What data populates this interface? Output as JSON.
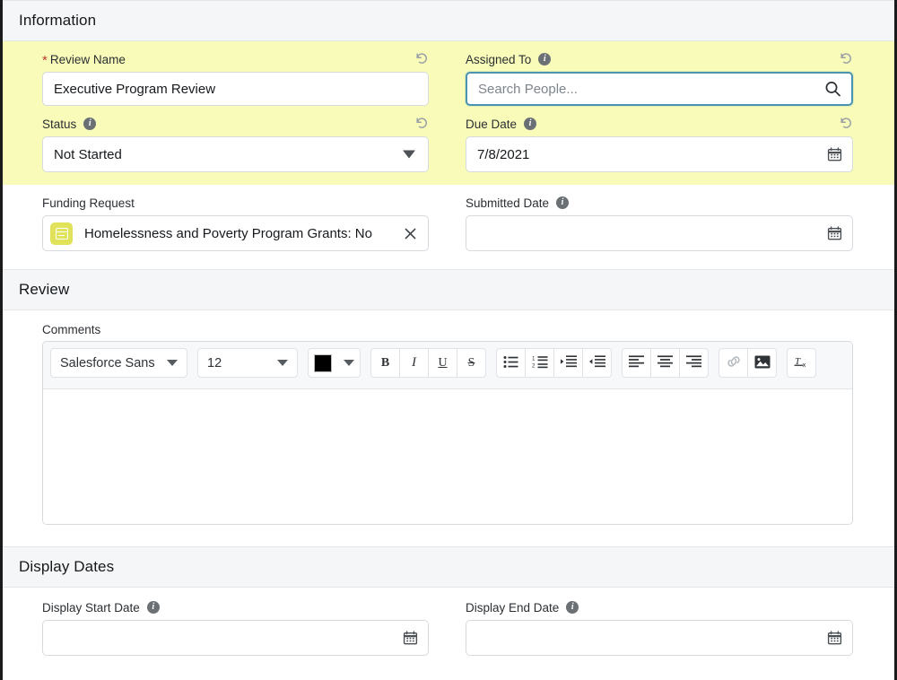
{
  "sections": {
    "information": {
      "title": "Information"
    },
    "review": {
      "title": "Review"
    },
    "display_dates": {
      "title": "Display Dates"
    }
  },
  "information": {
    "review_name": {
      "label": "Review Name",
      "required_marker": "*",
      "value": "Executive Program Review",
      "undo_icon": "undo-icon",
      "highlighted": true
    },
    "status": {
      "label": "Status",
      "value": "Not Started",
      "info_icon": "info-icon",
      "undo_icon": "undo-icon",
      "dropdown_icon": "chevron-down-icon",
      "highlighted": true
    },
    "funding_request": {
      "label": "Funding Request",
      "value": "Homelessness and Poverty Program Grants: No",
      "record_icon": "record-icon",
      "clear_icon": "close-icon"
    },
    "assigned_to": {
      "label": "Assigned To",
      "placeholder": "Search People...",
      "value": "",
      "info_icon": "info-icon",
      "undo_icon": "undo-icon",
      "search_icon": "search-icon",
      "focused": true,
      "highlighted": true
    },
    "due_date": {
      "label": "Due Date",
      "value": "7/8/2021",
      "info_icon": "info-icon",
      "undo_icon": "undo-icon",
      "calendar_icon": "calendar-icon",
      "highlighted": true
    },
    "submitted_date": {
      "label": "Submitted Date",
      "value": "",
      "info_icon": "info-icon",
      "calendar_icon": "calendar-icon"
    }
  },
  "review": {
    "comments": {
      "label": "Comments",
      "body_value": "",
      "toolbar": {
        "font_family": "Salesforce Sans",
        "font_size": "12",
        "text_color_hex": "#000000",
        "buttons": [
          {
            "name": "bold-button",
            "label": "B"
          },
          {
            "name": "italic-button",
            "label": "I"
          },
          {
            "name": "underline-button",
            "label": "U"
          },
          {
            "name": "strikethrough-button",
            "label": "S"
          },
          {
            "name": "bulleted-list-button",
            "label": ""
          },
          {
            "name": "numbered-list-button",
            "label": ""
          },
          {
            "name": "indent-button",
            "label": ""
          },
          {
            "name": "outdent-button",
            "label": ""
          },
          {
            "name": "align-left-button",
            "label": ""
          },
          {
            "name": "align-center-button",
            "label": ""
          },
          {
            "name": "align-right-button",
            "label": ""
          },
          {
            "name": "insert-link-button",
            "label": ""
          },
          {
            "name": "insert-image-button",
            "label": ""
          },
          {
            "name": "remove-formatting-button",
            "label": ""
          }
        ]
      }
    }
  },
  "display_dates": {
    "display_start_date": {
      "label": "Display Start Date",
      "value": "",
      "info_icon": "info-icon",
      "calendar_icon": "calendar-icon"
    },
    "display_end_date": {
      "label": "Display End Date",
      "value": "",
      "info_icon": "info-icon",
      "calendar_icon": "calendar-icon"
    }
  },
  "colors": {
    "highlight_yellow": "#f8fcb8",
    "section_header_bg": "#f4f6f8",
    "focus_border": "#4a94b2",
    "required_star": "#c23934",
    "record_icon_bg": "#e0e35a"
  }
}
